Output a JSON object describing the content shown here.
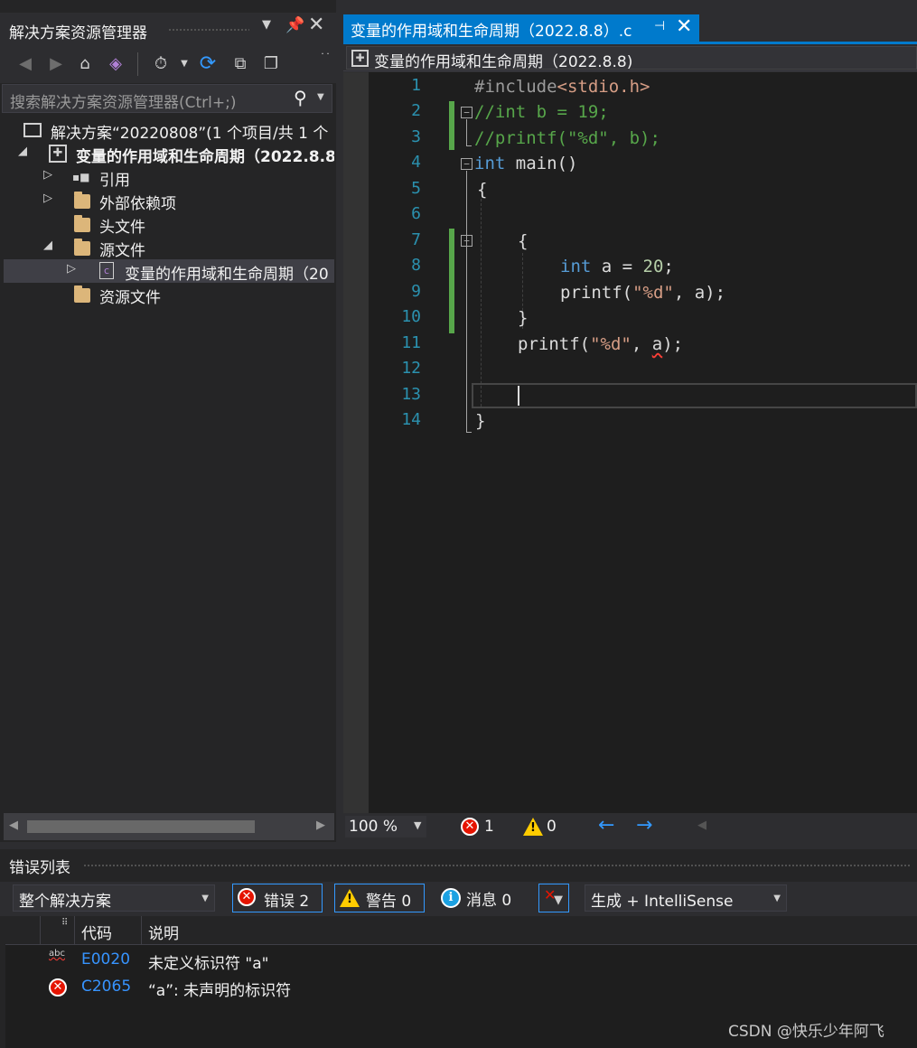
{
  "solution_explorer": {
    "title": "解决方案资源管理器",
    "search_placeholder": "搜索解决方案资源管理器(Ctrl+;)",
    "tree": {
      "solution": "解决方案“20220808”(1 个项目/共 1 个",
      "project": "变量的作用域和生命周期（2022.8.8",
      "references": "引用",
      "external_deps": "外部依赖项",
      "header_files": "头文件",
      "source_files": "源文件",
      "source_file": "变量的作用域和生命周期（20",
      "resource_files": "资源文件"
    }
  },
  "editor": {
    "tab_title": "变量的作用域和生命周期（2022.8.8）.c",
    "nav_project": "变量的作用域和生命周期（2022.8.8)",
    "line_numbers": [
      "1",
      "2",
      "3",
      "4",
      "5",
      "6",
      "7",
      "8",
      "9",
      "10",
      "11",
      "12",
      "13",
      "14"
    ],
    "code": {
      "l1_directive": "#include",
      "l1_header": "<stdio.h>",
      "l2": "//int b = 19;",
      "l3": "//printf(\"%d\", b);",
      "l4_kw": "int",
      "l4_rest": " main()",
      "l5": "{",
      "l7": "{",
      "l8_kw": "int",
      "l8_mid": " a = ",
      "l8_num": "20",
      "l8_end": ";",
      "l9_fn": "printf(",
      "l9_str": "\"%d\"",
      "l9_end": ", a);",
      "l10": "}",
      "l11_fn": "printf(",
      "l11_str": "\"%d\"",
      "l11_mid": ", ",
      "l11_err": "a",
      "l11_end": ");",
      "l14": "}"
    },
    "status": {
      "zoom": "100 %",
      "errors": "1",
      "warnings": "0"
    }
  },
  "error_list": {
    "title": "错误列表",
    "scope": "整个解决方案",
    "errors_label": "错误 2",
    "warnings_label": "警告 0",
    "messages_label": "消息 0",
    "source": "生成 + IntelliSense",
    "columns": {
      "code": "代码",
      "description": "说明"
    },
    "rows": [
      {
        "icon": "spell-abc-icon",
        "code": "E0020",
        "description": "未定义标识符 \"a\""
      },
      {
        "icon": "error-circle-icon",
        "code": "C2065",
        "description": "“a”: 未声明的标识符"
      }
    ]
  },
  "watermark": "CSDN @快乐少年阿飞",
  "colors": {
    "accent": "#007acc",
    "keyword": "#569cd6",
    "comment": "#57a64a",
    "string": "#d69d85",
    "number": "#b5cea8",
    "line_number": "#2b91af",
    "error": "#e51400"
  }
}
